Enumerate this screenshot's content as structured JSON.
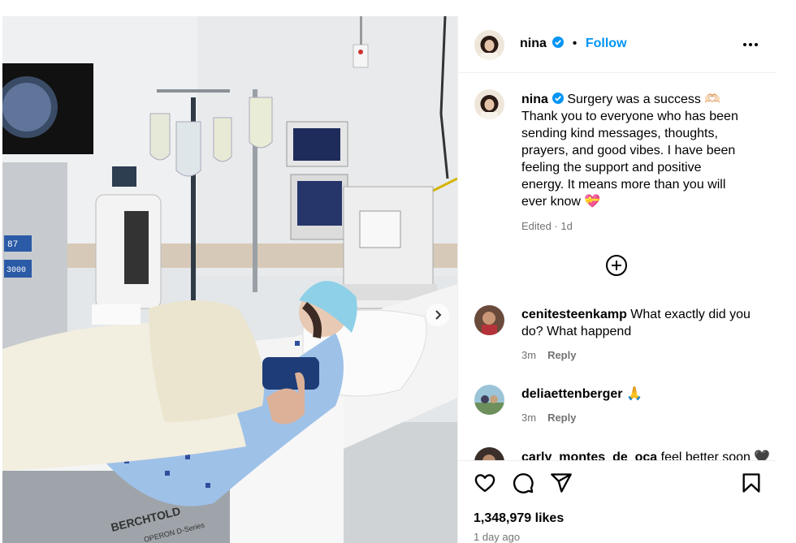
{
  "post": {
    "username": "nina",
    "follow_label": "Follow",
    "separator": "•",
    "caption_lines": [
      "Surgery was a success 🫶🏻",
      "Thank you to everyone who has been",
      "sending kind messages, thoughts,",
      "prayers, and good vibes. I have been",
      "feeling the support and positive",
      "energy. It means more than you will",
      "ever know 💝"
    ],
    "caption_meta": "Edited · 1d",
    "likes": "1,348,979 likes",
    "posted_ago": "1 day ago"
  },
  "comments": [
    {
      "username": "cenitesteenkamp",
      "text": "What exactly did you",
      "text_line2": "do? What happend",
      "time": "3m",
      "reply_label": "Reply"
    },
    {
      "username": "deliaettenberger",
      "text": "🙏",
      "time": "3m",
      "reply_label": "Reply"
    },
    {
      "username": "carly_montes_de_oca",
      "text": "feel better soon 🖤"
    }
  ],
  "photo_text": {
    "monitor_left_a": "87",
    "monitor_left_b": "3000",
    "bed_brand": "BERCHTOLD",
    "bed_model": "OPERON D-Series"
  },
  "colors": {
    "link_blue": "#0095f6",
    "muted": "#737373",
    "verified": "#0095f6"
  },
  "icons": [
    "verified-icon",
    "more-icon",
    "add-comment-icon",
    "heart-icon",
    "comment-icon",
    "share-icon",
    "bookmark-icon",
    "chevron-right-icon"
  ]
}
